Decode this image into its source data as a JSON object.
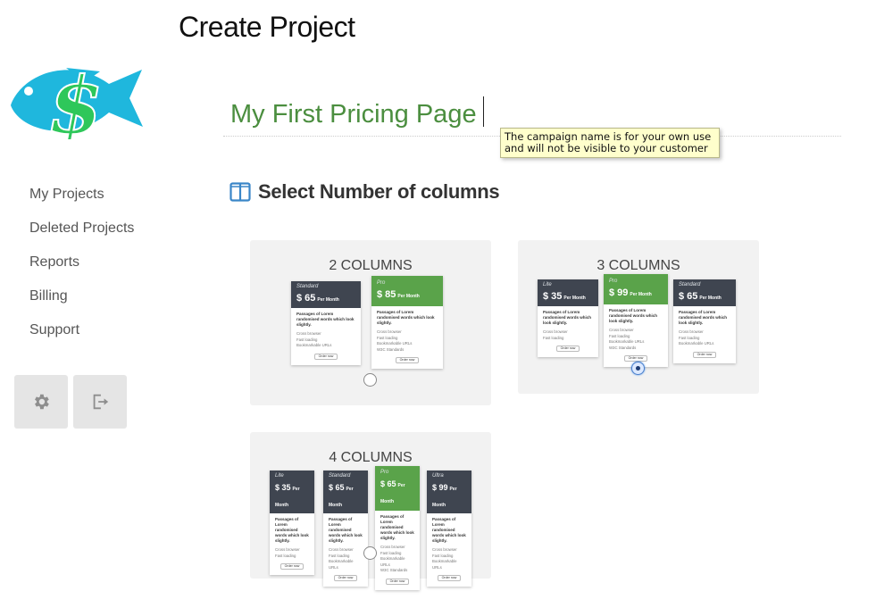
{
  "page": {
    "title": "Create Project"
  },
  "sidebar": {
    "logo": "fish-dollar-logo",
    "nav": [
      {
        "label": "My Projects"
      },
      {
        "label": "Deleted Projects"
      },
      {
        "label": "Reports"
      },
      {
        "label": "Billing"
      },
      {
        "label": "Support"
      }
    ],
    "buttons": [
      {
        "icon": "gear-icon"
      },
      {
        "icon": "logout-icon"
      }
    ]
  },
  "campaign": {
    "value": "My First Pricing Page",
    "tooltip": "The campaign name is for your own use and will not be visible to your customer"
  },
  "columns_section": {
    "title": "Select Number of columns",
    "icon": "columns-icon",
    "selected": 3,
    "options": [
      {
        "label": "2 COLUMNS",
        "selected": false
      },
      {
        "label": "3 COLUMNS",
        "selected": true
      },
      {
        "label": "4 COLUMNS",
        "selected": false
      }
    ]
  },
  "preview": {
    "per_month": "Per Month",
    "description": "Passages of Lorem randomised words which look slightly.",
    "order_button": "Order now",
    "plans": {
      "lite": {
        "name": "Lite",
        "price": "$ 35"
      },
      "standard": {
        "name": "Standard",
        "price": "$ 65"
      },
      "pro_85": {
        "name": "Pro",
        "price": "$ 85"
      },
      "pro_99": {
        "name": "Pro",
        "price": "$ 99"
      },
      "ultra": {
        "name": "Ultra",
        "price": "$ 99"
      }
    },
    "features": [
      "Cross browser",
      "Fast loading",
      "Bookmarkable URLs",
      "W3C Standards"
    ]
  },
  "colors": {
    "accent_green": "#4b8e3f",
    "featured_green": "#5aa34a",
    "dark_header": "#3f4550",
    "logo_blue": "#1fb7dd",
    "logo_green": "#2ec75a"
  }
}
